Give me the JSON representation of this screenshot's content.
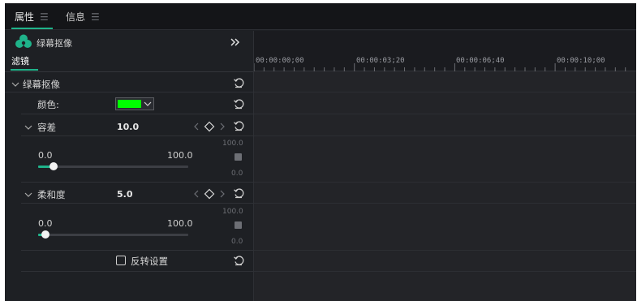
{
  "tabs": [
    {
      "label": "属性",
      "active": true
    },
    {
      "label": "信息",
      "active": false
    }
  ],
  "effect_header": {
    "title": "绿幕抠像",
    "subtab": "滤镜"
  },
  "timeline": {
    "ticks": [
      "00:00:00;00",
      "00:00:03;20",
      "00:00:06;40",
      "00:00:10;00"
    ]
  },
  "section": {
    "title": "绿幕抠像",
    "color_label": "颜色:",
    "color_value": "#00ff00",
    "tolerance": {
      "label": "容差",
      "value": "10.0",
      "min": "0.0",
      "max": "100.0",
      "graph_top": "100.0",
      "graph_bottom": "0.0",
      "fraction": 0.1
    },
    "softness": {
      "label": "柔和度",
      "value": "5.0",
      "min": "0.0",
      "max": "100.0",
      "graph_top": "100.0",
      "graph_bottom": "0.0",
      "fraction": 0.05
    },
    "invert_label": "反转设置"
  },
  "colors": {
    "accent": "#1fb38a",
    "panel": "#1e2024",
    "logo_green": "#1fb38a"
  },
  "icons": [
    "menu-icon",
    "green-screen-logo-icon",
    "double-chevron-right-icon",
    "chevron-down-icon",
    "reset-icon",
    "keyframe-diamond-icon",
    "prev-keyframe-icon",
    "next-keyframe-icon",
    "checkbox-icon"
  ]
}
